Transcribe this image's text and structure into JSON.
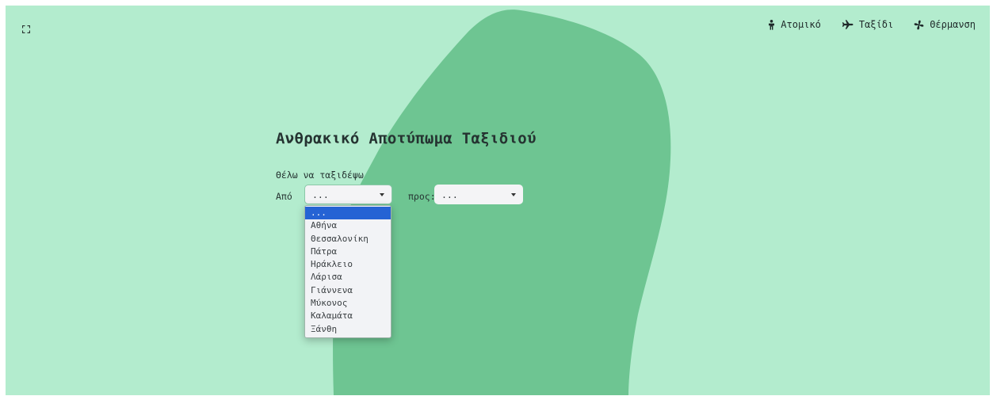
{
  "nav": {
    "items": [
      {
        "label": "Ατομικό",
        "icon": "person-icon"
      },
      {
        "label": "Ταξίδι",
        "icon": "airplane-icon"
      },
      {
        "label": "Θέρμανση",
        "icon": "fan-icon"
      }
    ]
  },
  "main": {
    "title": "Ανθρακικό Αποτύπωμα Ταξιδιού",
    "prompt": "Θέλω να ταξιδέψω",
    "from_label": "Από",
    "to_label": "προς:",
    "from_value": "...",
    "to_value": "..."
  },
  "dropdown": {
    "options": [
      "...",
      "Αθήνα",
      "Θεσσαλονίκη",
      "Πάτρα",
      "Ηράκλειο",
      "Λάρισα",
      "Γιάννενα",
      "Μύκονος",
      "Καλαμάτα",
      "Ξάνθη"
    ],
    "selected_index": 0
  },
  "colors": {
    "background": "#b3ecce",
    "blob": "#6ec592",
    "accent": "#2563d4"
  }
}
